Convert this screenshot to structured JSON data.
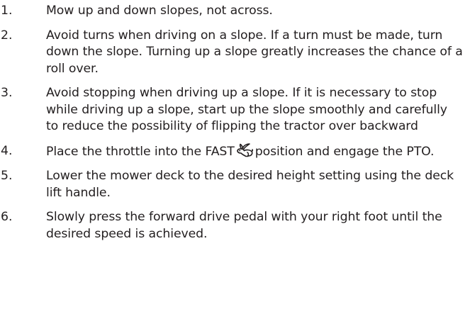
{
  "steps": [
    {
      "number": "1.",
      "text": "Mow up and down slopes, not across."
    },
    {
      "number": "2.",
      "text": "Avoid turns when driving on a slope. If a turn must be made, turn down the slope. Turning up a slope greatly increases the chance of a roll over."
    },
    {
      "number": "3.",
      "text": "Avoid stopping when driving up a slope. If it is necessary to stop while driving up a slope, start up the slope smoothly and carefully to reduce the possibility of flipping the tractor over backward"
    },
    {
      "number": "4.",
      "text_before_icon": "Place the throttle into the FAST",
      "icon": "rabbit-fast-icon",
      "text_after_icon": "position and engage the PTO."
    },
    {
      "number": "5.",
      "text": "Lower the mower deck to the desired height setting using the deck lift handle."
    },
    {
      "number": "6.",
      "text": "Slowly press the forward drive pedal with your right foot until the desired speed is achieved."
    }
  ]
}
